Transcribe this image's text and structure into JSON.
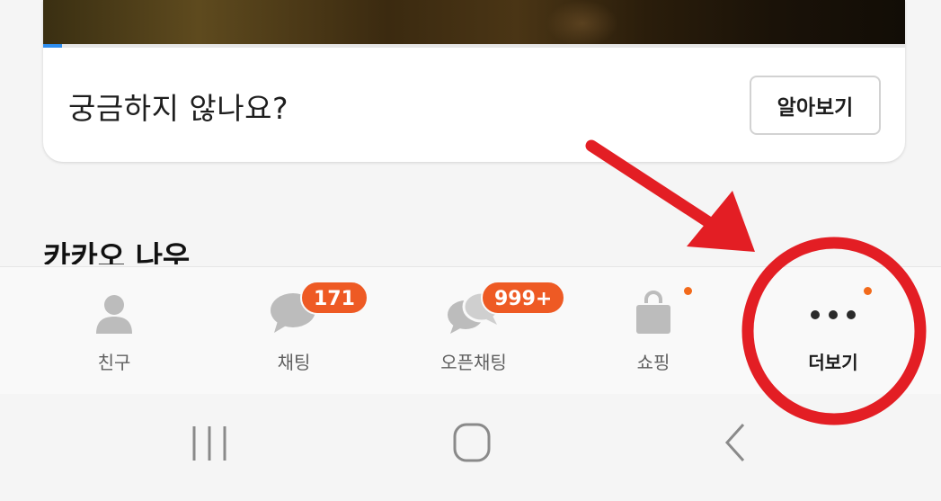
{
  "promo_card": {
    "title": "궁금하지 않나요?",
    "learn_more_label": "알아보기",
    "video_progress_fraction": 0.022
  },
  "section": {
    "title": "카카오 나우"
  },
  "tabs": [
    {
      "label": "친구",
      "icon": "person-icon"
    },
    {
      "label": "채팅",
      "icon": "chat-bubble-icon",
      "badge": "171"
    },
    {
      "label": "오픈채팅",
      "icon": "open-chat-icon",
      "badge": "999+"
    },
    {
      "label": "쇼핑",
      "icon": "shopping-bag-icon",
      "has_dot": true
    },
    {
      "label": "더보기",
      "icon": "more-icon",
      "has_dot": true,
      "active": true
    }
  ],
  "system_nav": {
    "items": [
      "recent-apps-icon",
      "home-icon",
      "back-icon"
    ]
  },
  "colors": {
    "badge": "#ee5a24",
    "annotation": "#e31e24",
    "progress": "#2f8ef0"
  }
}
